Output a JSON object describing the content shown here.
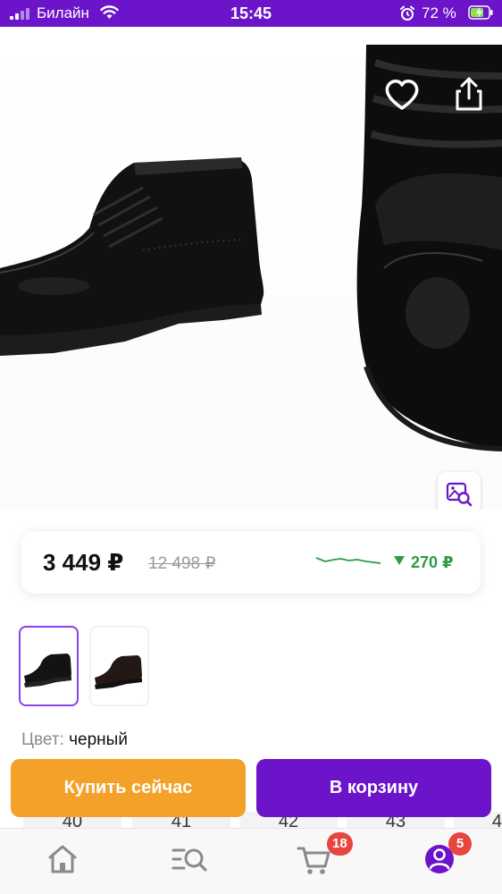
{
  "status_bar": {
    "carrier": "Билайн",
    "time": "15:45",
    "battery_percent": "72 %"
  },
  "product": {
    "price": "3 449 ₽",
    "old_price": "12 498 ₽",
    "price_drop": "270 ₽",
    "color_label": "Цвет:",
    "color_value": "черный",
    "selected_variant": 1
  },
  "sizes": [
    "40",
    "41",
    "42",
    "43",
    "4"
  ],
  "actions": {
    "buy_now": "Купить сейчас",
    "add_to_cart": "В корзину"
  },
  "tab_bar": {
    "cart_badge": "18",
    "profile_badge": "5"
  },
  "colors": {
    "brand_purple": "#6b14c9",
    "buy_orange": "#f4a12a",
    "price_drop_green": "#2e9b47",
    "badge_red": "#e6463d"
  },
  "icons": [
    "back-icon",
    "heart-icon",
    "share-icon",
    "visual-search-icon",
    "home-icon",
    "catalog-search-icon",
    "cart-icon",
    "profile-icon"
  ]
}
